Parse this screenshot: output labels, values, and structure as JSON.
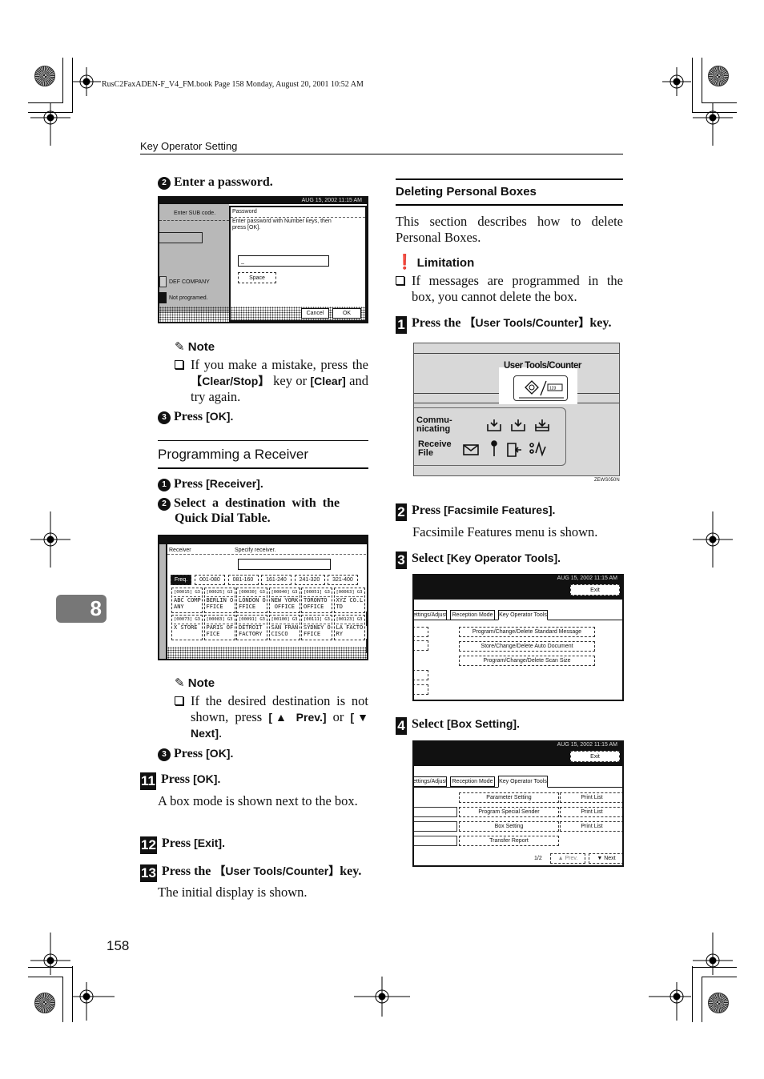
{
  "book_header": "RusC2FaxADEN-F_V4_FM.book  Page 158  Monday, August 20, 2001  10:52 AM",
  "running_head": "Key Operator Setting",
  "chapter_tab": "8",
  "page_number": "158",
  "left_column": {
    "step2_num": "2",
    "step2_text": "Enter a password.",
    "password_screen": {
      "datetime": "AUG 15, 2002 11:15 AM",
      "left_label": "Enter SUB code.",
      "entry1": "DEF  COMPANY",
      "entry2": "Not programed.",
      "dialog_title": "Password",
      "dialog_message_1": "Enter password with Number keys, then",
      "dialog_message_2": "press [OK].",
      "input_value": "_",
      "space_button": "Space",
      "cancel_button": "Cancel",
      "ok_button": "OK"
    },
    "note1_title": "Note",
    "note1_pre": "If you make a mistake, press the ",
    "note1_key1": "【Clear/Stop】",
    "note1_mid": " key or ",
    "note1_key2": "[Clear]",
    "note1_post": " and try again.",
    "step3_num": "3",
    "step3_pre": "Press ",
    "step3_key": "[OK].",
    "section_title": "Programming a Receiver",
    "rstep1_num": "1",
    "rstep1_pre": "Press ",
    "rstep1_key": "[Receiver].",
    "rstep2_num": "2",
    "rstep2_text_1": "Select  a  destination  with  the",
    "rstep2_text_2": "Quick Dial Table.",
    "receiver_screen": {
      "label": "Receiver",
      "prompt": "Specify receiver.",
      "tabs": [
        "Freq.",
        "001-080",
        "081-160",
        "161-240",
        "241-320",
        "321-400"
      ],
      "entries": [
        {
          "id": "[00015]",
          "mode": "G3",
          "name1": "ABC COMP",
          "name2": "ANY"
        },
        {
          "id": "[00025]",
          "mode": "G3",
          "name1": "BERLIN O",
          "name2": "FFICE"
        },
        {
          "id": "[00030]",
          "mode": "G3",
          "name1": "LONDON O",
          "name2": "FFICE"
        },
        {
          "id": "[00040]",
          "mode": "G3",
          "name1": "NEW YORK",
          "name2": " OFFICE"
        },
        {
          "id": "[00051]",
          "mode": "G3",
          "name1": "TORONTO",
          "name2": "OFFICE"
        },
        {
          "id": "[00063]",
          "mode": "G3",
          "name1": "XYZ CO.L",
          "name2": "TD"
        },
        {
          "id": "[00073]",
          "mode": "G3",
          "name1": "X STORE",
          "name2": ""
        },
        {
          "id": "[00083]",
          "mode": "G3",
          "name1": "PARIS OF",
          "name2": "FICE"
        },
        {
          "id": "[00091]",
          "mode": "G3",
          "name1": "DETROIT",
          "name2": "FACTORY"
        },
        {
          "id": "[00100]",
          "mode": "G3",
          "name1": "SAN FRAN",
          "name2": "CISCO"
        },
        {
          "id": "[00111]",
          "mode": "G3",
          "name1": "SYDNEY O",
          "name2": "FFICE"
        },
        {
          "id": "[00123]",
          "mode": "G3",
          "name1": "LA FACTO",
          "name2": "RY"
        }
      ]
    },
    "note2_title": "Note",
    "note2_pre": "If the desired destination is not shown, press ",
    "note2_key1": "[▲ Prev.]",
    "note2_mid": " or ",
    "note2_key2": "[▼ Next]",
    "note2_post": ".",
    "rstep3_num": "3",
    "rstep3_pre": "Press ",
    "rstep3_key": "[OK].",
    "step11_num": "11",
    "step11_pre": "Press ",
    "step11_key": "[OK].",
    "step11_desc": "A box mode is shown next to the box.",
    "step12_num": "12",
    "step12_pre": "Press ",
    "step12_key": "[Exit].",
    "step13_num": "13",
    "step13_pre": "Press the ",
    "step13_key": "【User Tools/Counter】",
    "step13_post": "key.",
    "step13_desc": "The initial display is shown."
  },
  "right_column": {
    "section_title": "Deleting Personal Boxes",
    "intro": "This section describes how to delete Personal Boxes.",
    "limitation_title": "Limitation",
    "limitation_text": "If messages are programmed in the box, you cannot delete the box.",
    "step1_num": "1",
    "step1_pre": "Press the ",
    "step1_key": "【User Tools/Counter】",
    "step1_post": "key.",
    "panel": {
      "key_label": "User Tools/Counter",
      "row1_label_1": "Commu-",
      "row1_label_2": "nicating",
      "row2_label_1": "Receive",
      "row2_label_2": "File",
      "code": "ZEWS050N"
    },
    "step2_num": "2",
    "step2_pre": "Press ",
    "step2_key": "[Facsimile Features].",
    "step2_desc": "Facsimile Features menu is shown.",
    "step3_num": "3",
    "step3_pre": "Select ",
    "step3_key": "[Key Operator Tools].",
    "screen3": {
      "datetime": "AUG 15, 2002 11:15 AM",
      "exit": "Exit",
      "tabs": [
        "ettings/Adjust",
        "Reception Mode",
        "Key Operator Tools"
      ],
      "buttons": [
        "Program/Change/Delete Standard Message",
        "Store/Change/Delete Auto Document",
        "Program/Change/Delete Scan Size"
      ]
    },
    "step4_num": "4",
    "step4_pre": "Select ",
    "step4_key": "[Box Setting].",
    "screen4": {
      "datetime": "AUG 15, 2002 11:15 AM",
      "exit": "Exit",
      "tabs": [
        "ettings/Adjust",
        "Reception Mode",
        "Key Operator Tools"
      ],
      "buttons": [
        "Parameter Setting",
        "Program Special Sender",
        "Box Setting",
        "Transfer Report"
      ],
      "print_list": "Print List",
      "page": "1/2",
      "prev": "▲ Prev.",
      "next": "▼ Next"
    }
  }
}
